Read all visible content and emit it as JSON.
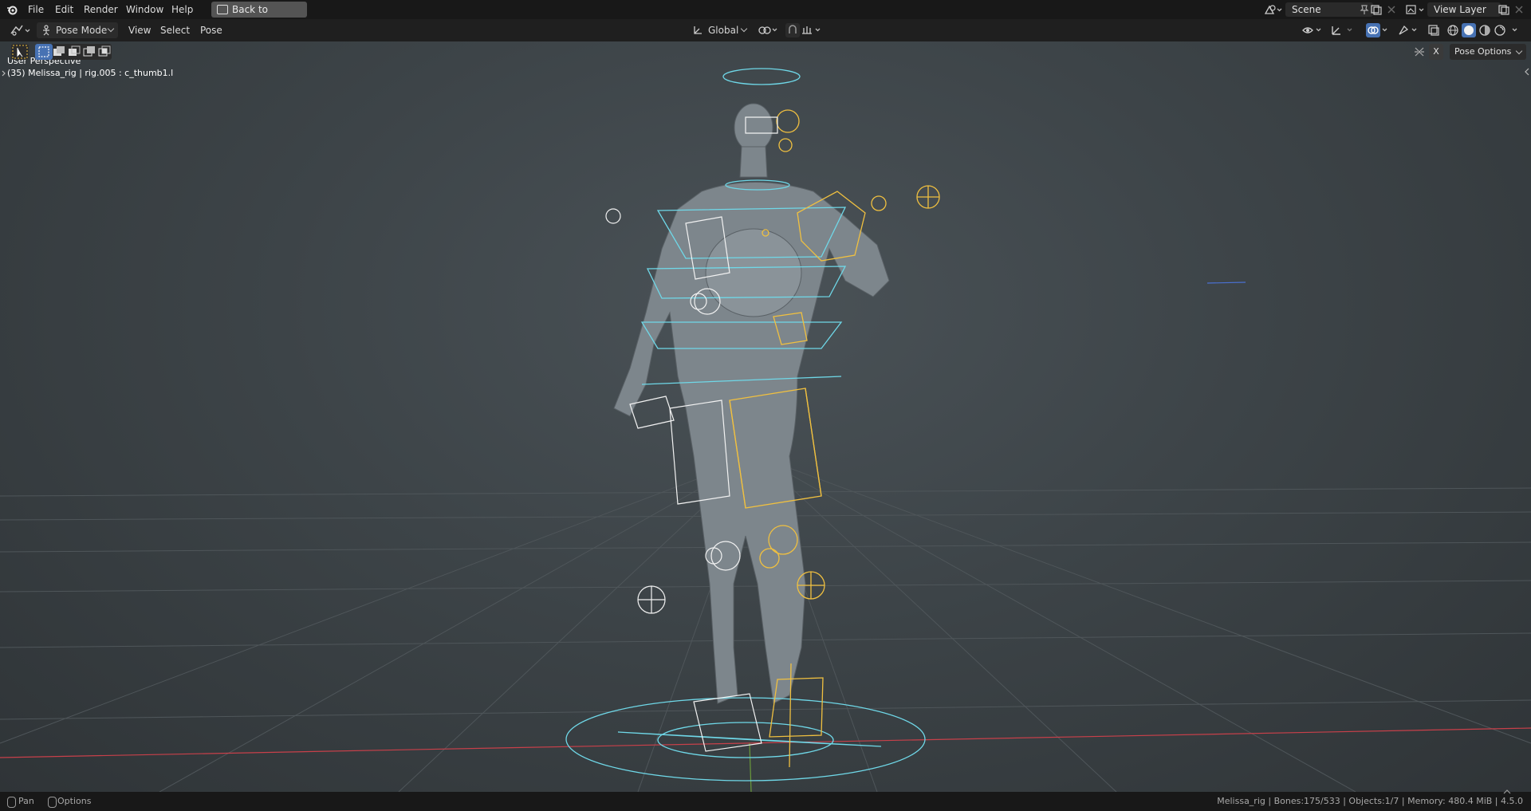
{
  "menubar": {
    "items": [
      "File",
      "Edit",
      "Render",
      "Window",
      "Help"
    ],
    "back_button": "Back to Previous",
    "scene_name": "Scene",
    "view_layer": "View Layer"
  },
  "header": {
    "mode": "Pose Mode",
    "menus": [
      "View",
      "Select",
      "Pose"
    ],
    "transform_orientation": "Global",
    "pose_options": "Pose Options",
    "x_label": "X"
  },
  "viewport": {
    "view_name": "User Perspective",
    "object_info": "(35) Melissa_rig | rig.005 : c_thumb1.l"
  },
  "statusbar": {
    "left_pan": "Pan",
    "left_options": "Options",
    "stats": "Melissa_rig | Bones:175/533 | Objects:1/7 | Memory: 480.4 MiB | 4.5.0"
  },
  "colors": {
    "accent_blue": "#4772b3",
    "bone_cyan": "#6fd8e8",
    "bone_yellow": "#f0c040",
    "axis_red": "#c8404a"
  }
}
